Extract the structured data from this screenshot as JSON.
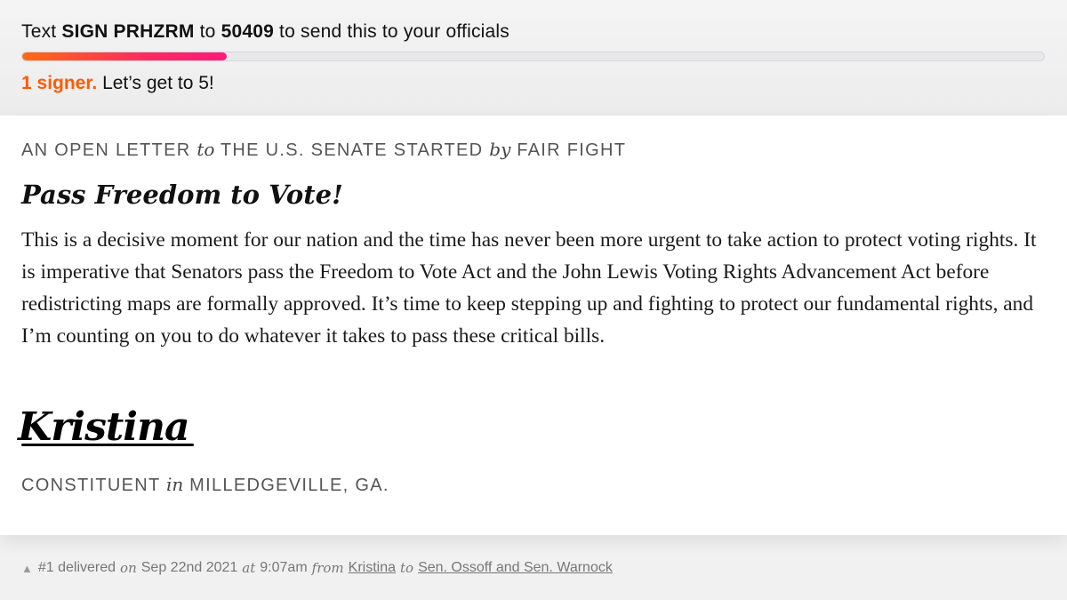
{
  "cta": {
    "prefix": "Text",
    "keyword": "SIGN PRHZRM",
    "to": "to",
    "number": "50409",
    "suffix": "to send this to your officials"
  },
  "progress": {
    "fraction": 0.2,
    "signers_count": "1 signer.",
    "signers_goal": "Let’s get to 5!"
  },
  "letter": {
    "kicker_part1": "AN OPEN LETTER",
    "kicker_to": "to",
    "kicker_part2": "THE U.S. SENATE STARTED",
    "kicker_by": "by",
    "kicker_part3": "FAIR FIGHT",
    "headline": "Pass Freedom to Vote!",
    "body": "This is a decisive moment for our nation and the time has never been more urgent to take action to protect voting rights. It is imperative that Senators pass the Freedom to Vote Act and the John Lewis Voting Rights Advancement Act before redistricting maps are formally approved. It’s time to keep stepping up and fighting to protect our fundamental rights, and I’m counting on you to do whatever it takes to pass these critical bills.",
    "signature": "Kristina",
    "location_part1": "CONSTITUENT",
    "location_in": "in",
    "location_part2": "MILLEDGEVILLE, GA."
  },
  "footer": {
    "delivered": "#1 delivered",
    "on": "on",
    "date": "Sep 22nd 2021",
    "at": "at",
    "time": "9:07am",
    "from": "from",
    "sender": "Kristina",
    "to": "to",
    "recipients": "Sen. Ossoff and Sen. Warnock"
  },
  "colors": {
    "accent": "#ff5a00",
    "progress_gradient_start": "#ff6a13",
    "progress_gradient_end": "#ff1a7a"
  }
}
